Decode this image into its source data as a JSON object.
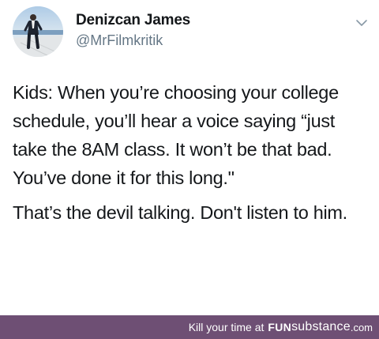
{
  "tweet": {
    "display_name": "Denizcan James",
    "handle": "@MrFilmkritik",
    "menu_icon": "chevron-down-icon",
    "avatar_icon": "profile-photo",
    "paragraphs": [
      "Kids: When you’re choosing your college schedule, you’ll hear a voice saying “just take the 8AM class. It won’t be that bad. You’ve done it for this long.\"",
      "That’s the devil talking. Don't listen to him."
    ]
  },
  "watermark": {
    "prefix": "Kill your time at",
    "brand_fun": "FUN",
    "brand_sub": "substance",
    "brand_com": ".com",
    "color": "#6e4f74"
  },
  "colors": {
    "name": "#14171a",
    "handle": "#657786",
    "text": "#14171a"
  }
}
